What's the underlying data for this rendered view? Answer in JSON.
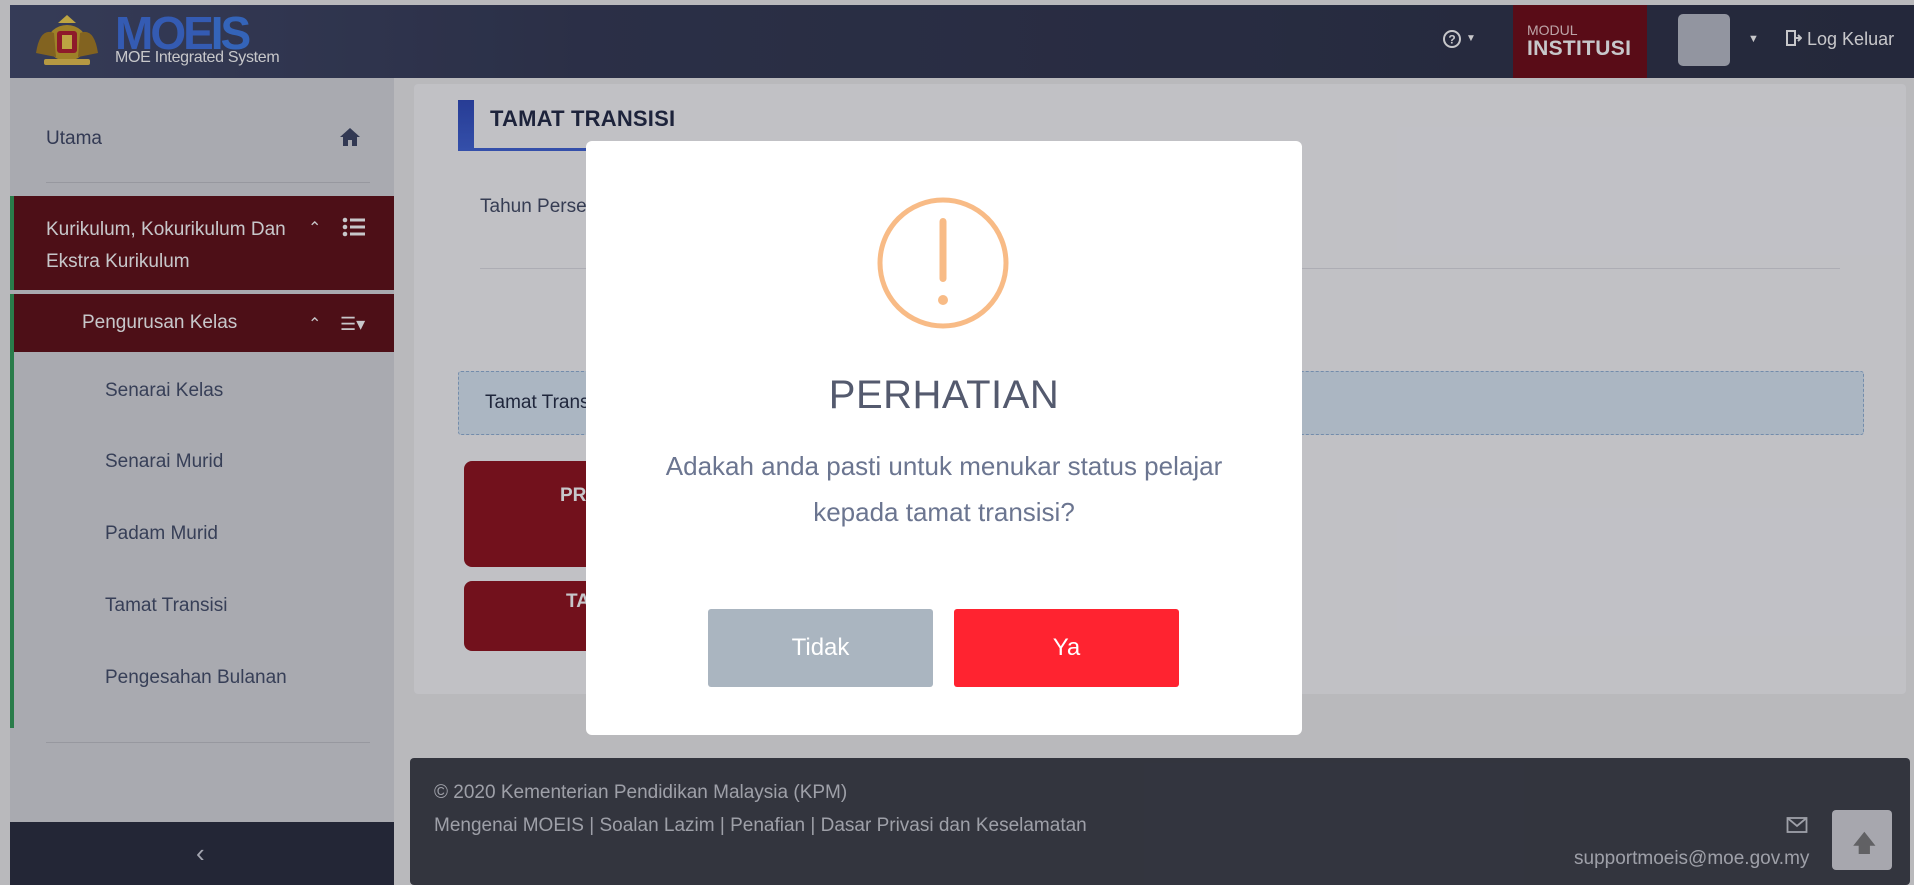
{
  "header": {
    "logo_text": "MOEIS",
    "logo_text_moe": "MOE",
    "logo_text_is": "IS",
    "logo_subtitle": "MOE Integrated System",
    "help_icon": "question-circle-icon",
    "modul_label": "MODUL",
    "modul_value": "INSTITUSI",
    "logout_label": "Log Keluar",
    "logout_icon": "sign-out-icon"
  },
  "sidebar": {
    "home_label": "Utama",
    "home_icon": "home-icon",
    "section_label": "Kurikulum, Kokurikulum Dan Ekstra Kurikulum",
    "section_icon": "list-icon",
    "subsection_label": "Pengurusan Kelas",
    "subsection_icon": "list-dropdown-icon",
    "items": [
      {
        "label": "Senarai Kelas"
      },
      {
        "label": "Senarai Murid"
      },
      {
        "label": "Padam Murid"
      },
      {
        "label": "Tamat Transisi"
      },
      {
        "label": "Pengesahan Bulanan"
      }
    ],
    "collapse_icon": "chevron-left-icon"
  },
  "main": {
    "title": "TAMAT TRANSISI",
    "tahun_label": "Tahun Perse",
    "info_text": "Tamat Trans",
    "button1_label": "PR",
    "button2_label": "TA"
  },
  "footer": {
    "copyright": "© 2020 Kementerian Pendidikan Malaysia (KPM)",
    "links": [
      "Mengenai MOEIS",
      "Soalan Lazim",
      "Penafian",
      "Dasar Privasi dan Keselamatan"
    ],
    "separator": " | ",
    "email": "supportmoeis@moe.gov.my",
    "mail_icon": "envelope-icon",
    "scroll_top_icon": "arrow-up-icon"
  },
  "modal": {
    "icon": "exclamation-circle-icon",
    "icon_color": "#f8bb86",
    "title": "PERHATIAN",
    "message": "Adakah anda pasti untuk menukar status pelajar kepada tamat transisi?",
    "cancel_label": "Tidak",
    "confirm_label": "Ya",
    "cancel_color": "#aab5c0",
    "confirm_color": "#ff2330"
  },
  "colors": {
    "accent_red": "#8e0d17",
    "sidebar_active": "#5c0a10",
    "active_border": "#2e9b55",
    "title_blue": "#3b5fd4"
  }
}
